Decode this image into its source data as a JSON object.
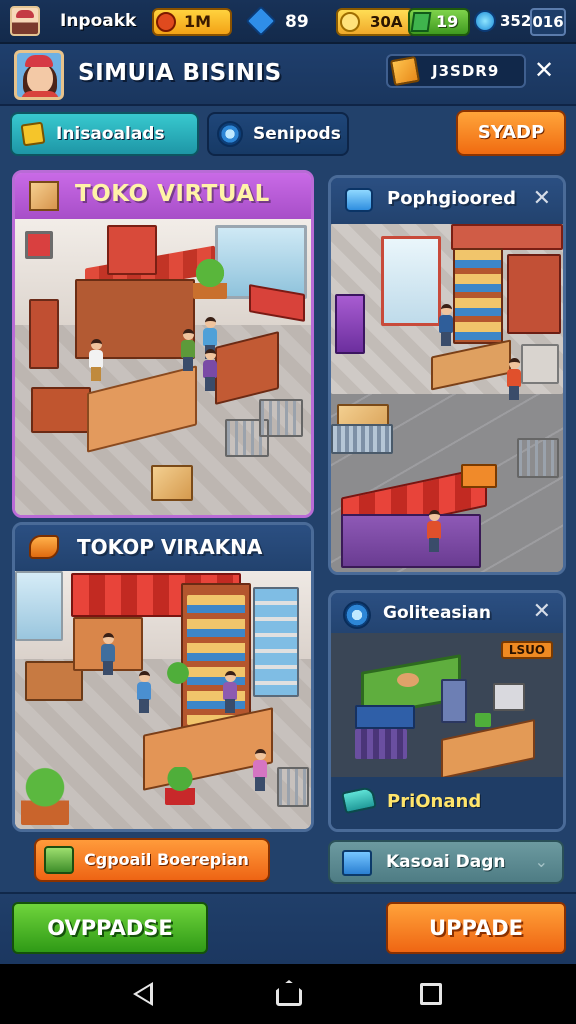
{
  "status_bar": {
    "app_name": "Inpoakk",
    "currency_1": "1M",
    "gems": "89",
    "gold": "30A",
    "green": "19",
    "diamonds": "352",
    "level": "016"
  },
  "header": {
    "title": "SIMUIA BISINIS",
    "box_label": "J3SDR9",
    "close": "✕"
  },
  "tabs": {
    "tab1": "Inisaoalads",
    "tab2": "Senipods",
    "action": "SYADP"
  },
  "cards": {
    "a": {
      "title": "TOKO VIRTUAL"
    },
    "b": {
      "title": "TOKOP VIRAKNA"
    },
    "c": {
      "title": "Pophgioored",
      "close": "✕"
    },
    "d": {
      "title": "Goliteasian",
      "close": "✕",
      "badge": "LSUO",
      "footer": "PriOnand"
    }
  },
  "buttons": {
    "cpoall": "Cgpoail Boerepian",
    "kasoai": "Kasoai Dagn",
    "kasoai_chevron": "⌄",
    "left": "OVPPADSE",
    "right": "UPPADE"
  },
  "colors": {
    "accent_orange": "#ef6613",
    "accent_green": "#2f9a16",
    "panel_blue": "#22416b"
  },
  "icons": {
    "nav_back": "back-triangle-icon",
    "nav_home": "home-icon",
    "nav_recent": "recent-apps-icon"
  }
}
